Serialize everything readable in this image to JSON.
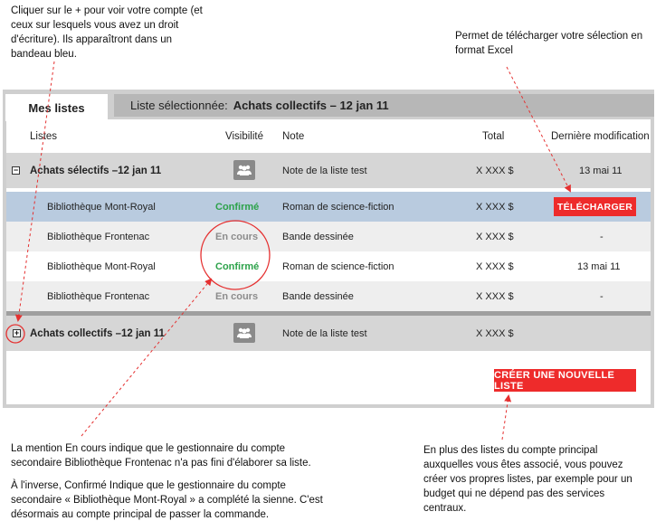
{
  "annotations": {
    "top_left": "Cliquer sur le + pour voir votre compte (et ceux sur lesquels vous avez un droit d'écriture). Ils apparaîtront dans un bandeau bleu.",
    "top_right": "Permet de télécharger votre sélection en format Excel",
    "bottom_left_1": "La mention En cours indique que le gestionnaire du compte secondaire Bibliothèque Frontenac n'a pas fini d'élaborer sa liste.",
    "bottom_left_2": "À l'inverse, Confirmé Indique que le gestionnaire du compte secondaire « Bibliothèque Mont-Royal » a complété la sienne. C'est désormais au compte principal de passer la commande.",
    "bottom_right": "En plus des listes du compte principal auxquelles vous êtes associé, vous pouvez créer vos propres listes, par exemple pour un budget qui ne dépend pas des services centraux."
  },
  "tabs": {
    "active": "Mes listes",
    "selected_prefix": "Liste sélectionnée:",
    "selected_value": "Achats collectifs – 12 jan  11"
  },
  "columns": {
    "lists": "Listes",
    "visibility": "Visibilité",
    "note": "Note",
    "total": "Total",
    "last_modified": "Dernière modification"
  },
  "groups": [
    {
      "toggle": "−",
      "name": "Achats sélectifs –12 jan 11",
      "visibility_icon": "group-icon",
      "note": "Note de la liste test",
      "total": "X XXX $",
      "modified": "13 mai 11"
    },
    {
      "toggle": "+",
      "name": "Achats collectifs –12 jan 11",
      "visibility_icon": "group-icon",
      "note": "Note de la liste test",
      "total": "X XXX $",
      "modified": ""
    }
  ],
  "rows": [
    {
      "name": "Bibliothèque Mont-Royal",
      "status": "Confirmé",
      "note": "Roman de science-fiction",
      "total": "X XXX $",
      "modified": "",
      "action": "TÉLÉCHARGER"
    },
    {
      "name": "Bibliothèque Frontenac",
      "status": "En cours",
      "note": "Bande dessinée",
      "total": "X XXX $",
      "modified": "-"
    },
    {
      "name": "Bibliothèque Mont-Royal",
      "status": "Confirmé",
      "note": "Roman de science-fiction",
      "total": "X XXX $",
      "modified": "13 mai 11"
    },
    {
      "name": "Bibliothèque Frontenac",
      "status": "En cours",
      "note": "Bande dessinée",
      "total": "X XXX $",
      "modified": "-"
    }
  ],
  "buttons": {
    "create_list": "CRÉER UNE NOUVELLE LISTE"
  },
  "colors": {
    "accent_red": "#ee2b2b",
    "confirmed_green": "#2ca24a",
    "selected_row_blue": "#b9cbdf"
  }
}
